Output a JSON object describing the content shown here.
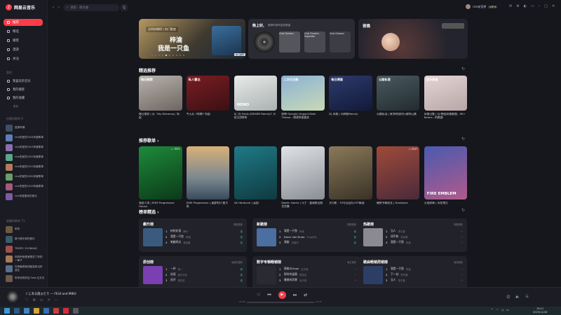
{
  "app": {
    "name": "网易云音乐"
  },
  "sidebar": {
    "nav": [
      {
        "label": "推荐"
      },
      {
        "label": "精选"
      },
      {
        "label": "播客"
      },
      {
        "label": "漫游"
      },
      {
        "label": "关注"
      }
    ],
    "my_label": "我的",
    "my": [
      {
        "label": "我喜欢的音乐"
      },
      {
        "label": "我的播客"
      },
      {
        "label": "我的收藏"
      },
      {
        "label": "更多"
      }
    ],
    "created_label": "创建的歌单 9",
    "playlists": [
      {
        "name": "蓝调专辑",
        "color": "#3d4e66"
      },
      {
        "name": "rice安室的2024年度歌单",
        "color": "#5b7fb1"
      },
      {
        "name": "rice安室的2023年度歌单",
        "color": "#8a6fb0"
      },
      {
        "name": "rice安室的2022年度歌单",
        "color": "#5aa58b"
      },
      {
        "name": "rice安室的2021年度歌单",
        "color": "#b07c5a"
      },
      {
        "name": "rice安室的2020年度歌单",
        "color": "#6c9c6b"
      },
      {
        "name": "rice安室的2019年度歌单",
        "color": "#a35a7c"
      },
      {
        "name": "rice安室喜欢的音乐",
        "color": "#7c5aa3"
      }
    ],
    "fav_label": "收藏的歌单 71",
    "favs": [
      {
        "name": "听听",
        "color": "#6a5a40"
      },
      {
        "name": "新兴音乐家的音乐",
        "color": "#3b5a6e"
      },
      {
        "name": "TEMPO《HONKAI》",
        "color": "#a0504a"
      },
      {
        "name": "你的声音是我想念了你的一辈子",
        "color": "#a37a5a"
      },
      {
        "name": "在夜晚把我的脑袋拿出来放在",
        "color": "#5a6e8a"
      },
      {
        "name": "听你说的的话 Feat.五月天",
        "color": "#6e5a4a"
      }
    ]
  },
  "topbar": {
    "search_placeholder": "搜索 · 歌名曲",
    "user": "rice安室原",
    "vip": "VIP·9",
    "back": "‹",
    "forward": "›"
  },
  "banner": {
    "tag": "全网热播榜 | 热门歌曲",
    "line1": "梓渝",
    "line2": "我是一只鱼",
    "badge": "热门推荐"
  },
  "daily": {
    "title": "晚上好,",
    "subtitle": "推荐你收听这些歌曲",
    "items": [
      {
        "caption": "Club Classics"
      },
      {
        "caption": "Club Classics Superstar"
      },
      {
        "caption": "Club Classics"
      }
    ]
  },
  "night": {
    "title": "夜晚"
  },
  "section_recommend": {
    "title": "精选推荐"
  },
  "recommend": [
    {
      "label": "每日推荐",
      "title": "每日推荐 | 从「My Dilemma」听起",
      "bg": "linear-gradient(160deg,#b9b3ad,#6d6660)"
    },
    {
      "label": "私人雷达",
      "title": "今天从《傍晚》听起",
      "bg": "linear-gradient(160deg,#7a1d22,#3b1014)"
    },
    {
      "label": "",
      "title": "从《It Feels (KSHMR Remix)》开启沉浸聆听",
      "bg": "linear-gradient(160deg,#e8ecea,#aab0b0)",
      "big": "NENO"
    },
    {
      "label": "二次元日推",
      "title": "原神 Genshin Impact Main Theme...预测你很喜欢",
      "bg": "linear-gradient(160deg,#8bb2d6,#c8d9b5)"
    },
    {
      "label": "每日搏蛋",
      "title": "DJ 风格 | DJ神秘Remix)",
      "bg": "linear-gradient(160deg,#2d3a6b,#121a3a)"
    },
    {
      "label": "公路私语",
      "title": "公路私语 | 有你的陪伴行驶的心跳",
      "bg": "linear-gradient(160deg,#4a5a60,#222c30)"
    },
    {
      "label": "音乐频道",
      "title": "风格日推 | DJ 韩国风格歌曲，99+ Remix...的歌曲",
      "bg": "linear-gradient(160deg,#e4d5d5,#b8a6a6)"
    }
  ],
  "section_playlists": {
    "title": "推荐歌单 ›"
  },
  "playlists": [
    {
      "title": "强迫人类 | EDM Progressive House",
      "count": "▷ 7875",
      "bg": "linear-gradient(160deg,#1e8a3a,#0b3a18)"
    },
    {
      "title": "EDM Progressive | 漫游的开·曲大热",
      "count": "",
      "bg": "linear-gradient(180deg,#d8b078,#7a8890 60%,#3a4a5c)"
    },
    {
      "title": "UK Hardcore | 英国",
      "count": "",
      "bg": "linear-gradient(160deg,#1f7a86,#0f3a40)"
    },
    {
      "title": "Martin Garrix | 马丁 · 盖瑞斯全曲目合集",
      "count": "",
      "bg": "linear-gradient(160deg,#dfe2e6,#8a8e94)"
    },
    {
      "title": "光与影 · 33号远征队OST精选",
      "count": "",
      "bg": "linear-gradient(160deg,#8a7a5a,#3a3226)"
    },
    {
      "title": "硬核节奏成长 | Hardstyle",
      "count": "▷ 9207",
      "bg": "linear-gradient(160deg,#a04a3a,#4a2a3a)"
    },
    {
      "title": "火焰纹章 | 风花雪月",
      "count": "",
      "bg": "linear-gradient(160deg,#4a5ab0,#b05a8a)",
      "big": "FIRE EMBLEM"
    }
  ],
  "section_ranks": {
    "title": "榜单精选 ›"
  },
  "ranks": [
    {
      "title": "飙升榜",
      "update": "刚刚更新",
      "cover": "#3a5b7e",
      "rows": [
        {
          "n": "1",
          "song": "树的花语",
          "artist": "腾讯",
          "tag": "新"
        },
        {
          "n": "2",
          "song": "我是一只鱼",
          "artist": "梓渝",
          "tag": "新"
        },
        {
          "n": "3",
          "song": "笔触四点",
          "artist": "易晓峰",
          "tag": "新"
        }
      ]
    },
    {
      "title": "新歌榜",
      "update": "刚刚更新",
      "cover": "#4a6fa0",
      "rows": [
        {
          "n": "1",
          "song": "我是一只鱼",
          "artist": "梓渝",
          "tag": "新"
        },
        {
          "n": "2",
          "song": "Black Veil Bride",
          "artist": "Ring乐队",
          "tag": "新"
        },
        {
          "n": "3",
          "song": "我能",
          "artist": "刘德华",
          "tag": "新"
        }
      ]
    },
    {
      "title": "热歌榜",
      "update": "刚刚更新",
      "cover": "#8a8a90",
      "rows": [
        {
          "n": "1",
          "song": "当人",
          "artist": "李宇春",
          "tag": "—"
        },
        {
          "n": "2",
          "song": "如平和",
          "artist": "范玮琪",
          "tag": "—"
        },
        {
          "n": "3",
          "song": "我是一只鱼",
          "artist": "梓渝",
          "tag": "—"
        }
      ]
    },
    {
      "title": "原创榜",
      "update": "每周四更新",
      "cover": "#7a3fb0",
      "rows": [
        {
          "n": "1",
          "song": "一杯",
          "artist": "杨一",
          "tag": "新"
        },
        {
          "n": "2",
          "song": "花语",
          "artist": "我们乐队",
          "tag": "新"
        },
        {
          "n": "3",
          "song": "花开",
          "artist": "周杰伦",
          "tag": "新"
        }
      ]
    },
    {
      "title": "数字专辑畅销榜",
      "update": "每日更新",
      "cover": "#2a2a32",
      "rows": [
        {
          "n": "1",
          "song": "黑暗与Hope",
          "artist": "毛不易",
          "tag": "—"
        },
        {
          "n": "2",
          "song": "那时的温柔",
          "artist": "陈奕迅",
          "tag": "—"
        },
        {
          "n": "3",
          "song": "最美的风景",
          "artist": "毛不易",
          "tag": "—"
        }
      ]
    },
    {
      "title": "歌曲畅销周销榜",
      "update": "每周更新",
      "cover": "#2d3e66",
      "rows": [
        {
          "n": "1",
          "song": "我是一只鱼",
          "artist": "梓渝",
          "tag": "—"
        },
        {
          "n": "2",
          "song": "下一站",
          "artist": "李宇春",
          "tag": "—"
        },
        {
          "n": "3",
          "song": "当人",
          "artist": "李宇春",
          "tag": "—"
        }
      ]
    }
  ],
  "player": {
    "title": "くじある旅ぉたり — FEUI and MIKU",
    "time_current": "00:00",
    "time_total": "03:26"
  },
  "taskbar": {
    "time": "19:11",
    "date": "2025/11/18"
  }
}
